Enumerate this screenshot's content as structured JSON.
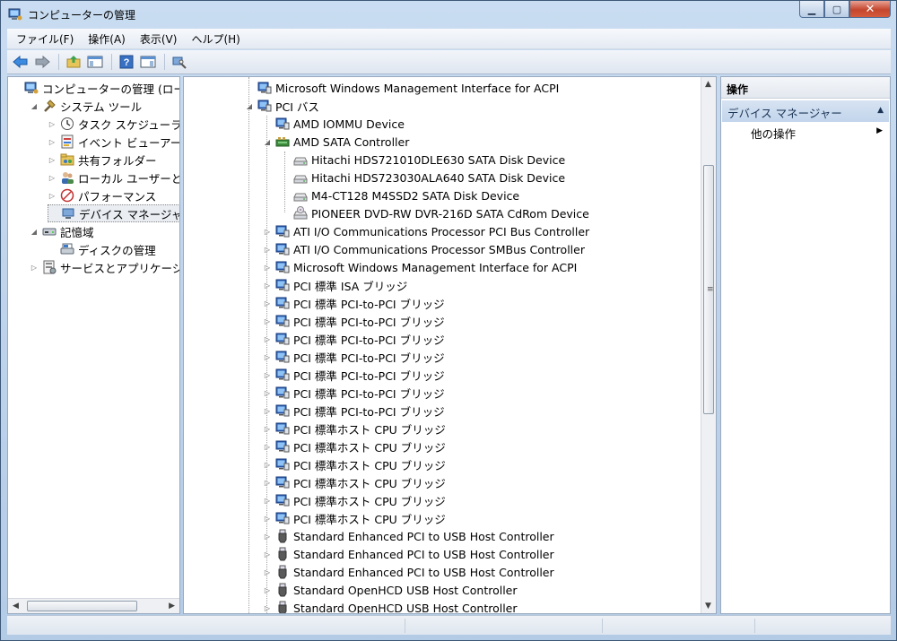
{
  "window": {
    "title": "コンピューターの管理",
    "icons": {
      "app": "computer-management-icon",
      "minimize": "minimize-icon",
      "maximize": "maximize-icon",
      "close": "close-icon"
    }
  },
  "menu": [
    "ファイル(F)",
    "操作(A)",
    "表示(V)",
    "ヘルプ(H)"
  ],
  "toolbar": [
    {
      "name": "back-icon"
    },
    {
      "name": "forward-icon"
    },
    {
      "name": "up-folder-icon"
    },
    {
      "name": "show-hide-console-tree-icon"
    },
    {
      "name": "help-icon"
    },
    {
      "name": "show-hide-action-pane-icon"
    },
    {
      "name": "device-properties-icon"
    }
  ],
  "left_tree": [
    {
      "label": "コンピューターの管理 (ローカ",
      "icon": "computer-management-icon",
      "level": 0,
      "expander": ""
    },
    {
      "label": "システム ツール",
      "icon": "tools-icon",
      "level": 1,
      "expander": "open"
    },
    {
      "label": "タスク スケジューラ",
      "icon": "clock-icon",
      "level": 2,
      "expander": "closed"
    },
    {
      "label": "イベント ビューアー",
      "icon": "event-viewer-icon",
      "level": 2,
      "expander": "closed"
    },
    {
      "label": "共有フォルダー",
      "icon": "shared-folder-icon",
      "level": 2,
      "expander": "closed"
    },
    {
      "label": "ローカル ユーザーとグ",
      "icon": "users-icon",
      "level": 2,
      "expander": "closed"
    },
    {
      "label": "パフォーマンス",
      "icon": "performance-icon",
      "level": 2,
      "expander": "closed"
    },
    {
      "label": "デバイス マネージャー",
      "icon": "device-manager-icon",
      "level": 2,
      "expander": "",
      "selected": true
    },
    {
      "label": "記憶域",
      "icon": "storage-icon",
      "level": 1,
      "expander": "open"
    },
    {
      "label": "ディスクの管理",
      "icon": "disk-management-icon",
      "level": 2,
      "expander": ""
    },
    {
      "label": "サービスとアプリケーショ",
      "icon": "services-icon",
      "level": 1,
      "expander": "closed"
    }
  ],
  "device_tree": [
    {
      "label": "Microsoft Windows Management Interface for ACPI",
      "icon": "system-device-icon",
      "level": 0,
      "expander": ""
    },
    {
      "label": "PCI バス",
      "icon": "system-device-icon",
      "level": 0,
      "expander": "open"
    },
    {
      "label": "AMD IOMMU Device",
      "icon": "system-device-icon",
      "level": 1,
      "expander": ""
    },
    {
      "label": "AMD SATA Controller",
      "icon": "storage-controller-icon",
      "level": 1,
      "expander": "open"
    },
    {
      "label": "Hitachi HDS721010DLE630 SATA Disk Device",
      "icon": "disk-drive-icon",
      "level": 2,
      "expander": ""
    },
    {
      "label": "Hitachi HDS723030ALA640 SATA Disk Device",
      "icon": "disk-drive-icon",
      "level": 2,
      "expander": ""
    },
    {
      "label": "M4-CT128 M4SSD2 SATA Disk Device",
      "icon": "disk-drive-icon",
      "level": 2,
      "expander": ""
    },
    {
      "label": "PIONEER DVD-RW  DVR-216D SATA CdRom Device",
      "icon": "cdrom-icon",
      "level": 2,
      "expander": ""
    },
    {
      "label": "ATI I/O Communications Processor PCI Bus Controller",
      "icon": "system-device-icon",
      "level": 1,
      "expander": "closed"
    },
    {
      "label": "ATI I/O Communications Processor SMBus Controller",
      "icon": "system-device-icon",
      "level": 1,
      "expander": "closed"
    },
    {
      "label": "Microsoft Windows Management Interface for ACPI",
      "icon": "system-device-icon",
      "level": 1,
      "expander": "closed"
    },
    {
      "label": "PCI 標準 ISA ブリッジ",
      "icon": "system-device-icon",
      "level": 1,
      "expander": "closed"
    },
    {
      "label": "PCI 標準 PCI-to-PCI ブリッジ",
      "icon": "system-device-icon",
      "level": 1,
      "expander": "closed"
    },
    {
      "label": "PCI 標準 PCI-to-PCI ブリッジ",
      "icon": "system-device-icon",
      "level": 1,
      "expander": "closed"
    },
    {
      "label": "PCI 標準 PCI-to-PCI ブリッジ",
      "icon": "system-device-icon",
      "level": 1,
      "expander": "closed"
    },
    {
      "label": "PCI 標準 PCI-to-PCI ブリッジ",
      "icon": "system-device-icon",
      "level": 1,
      "expander": "closed"
    },
    {
      "label": "PCI 標準 PCI-to-PCI ブリッジ",
      "icon": "system-device-icon",
      "level": 1,
      "expander": "closed"
    },
    {
      "label": "PCI 標準 PCI-to-PCI ブリッジ",
      "icon": "system-device-icon",
      "level": 1,
      "expander": "closed"
    },
    {
      "label": "PCI 標準 PCI-to-PCI ブリッジ",
      "icon": "system-device-icon",
      "level": 1,
      "expander": "closed"
    },
    {
      "label": "PCI 標準ホスト CPU ブリッジ",
      "icon": "system-device-icon",
      "level": 1,
      "expander": "closed"
    },
    {
      "label": "PCI 標準ホスト CPU ブリッジ",
      "icon": "system-device-icon",
      "level": 1,
      "expander": "closed"
    },
    {
      "label": "PCI 標準ホスト CPU ブリッジ",
      "icon": "system-device-icon",
      "level": 1,
      "expander": "closed"
    },
    {
      "label": "PCI 標準ホスト CPU ブリッジ",
      "icon": "system-device-icon",
      "level": 1,
      "expander": "closed"
    },
    {
      "label": "PCI 標準ホスト CPU ブリッジ",
      "icon": "system-device-icon",
      "level": 1,
      "expander": "closed"
    },
    {
      "label": "PCI 標準ホスト CPU ブリッジ",
      "icon": "system-device-icon",
      "level": 1,
      "expander": "closed"
    },
    {
      "label": "Standard Enhanced PCI to USB Host Controller",
      "icon": "usb-icon",
      "level": 1,
      "expander": "closed"
    },
    {
      "label": "Standard Enhanced PCI to USB Host Controller",
      "icon": "usb-icon",
      "level": 1,
      "expander": "closed"
    },
    {
      "label": "Standard Enhanced PCI to USB Host Controller",
      "icon": "usb-icon",
      "level": 1,
      "expander": "closed"
    },
    {
      "label": "Standard OpenHCD USB Host Controller",
      "icon": "usb-icon",
      "level": 1,
      "expander": "closed"
    },
    {
      "label": "Standard OpenHCD USB Host Controller",
      "icon": "usb-icon",
      "level": 1,
      "expander": "closed"
    }
  ],
  "actions": {
    "header": "操作",
    "group": "デバイス マネージャー",
    "items": [
      "他の操作"
    ]
  },
  "colors": {
    "selection": "#eaeef3",
    "accent": "#c2d5ec"
  }
}
